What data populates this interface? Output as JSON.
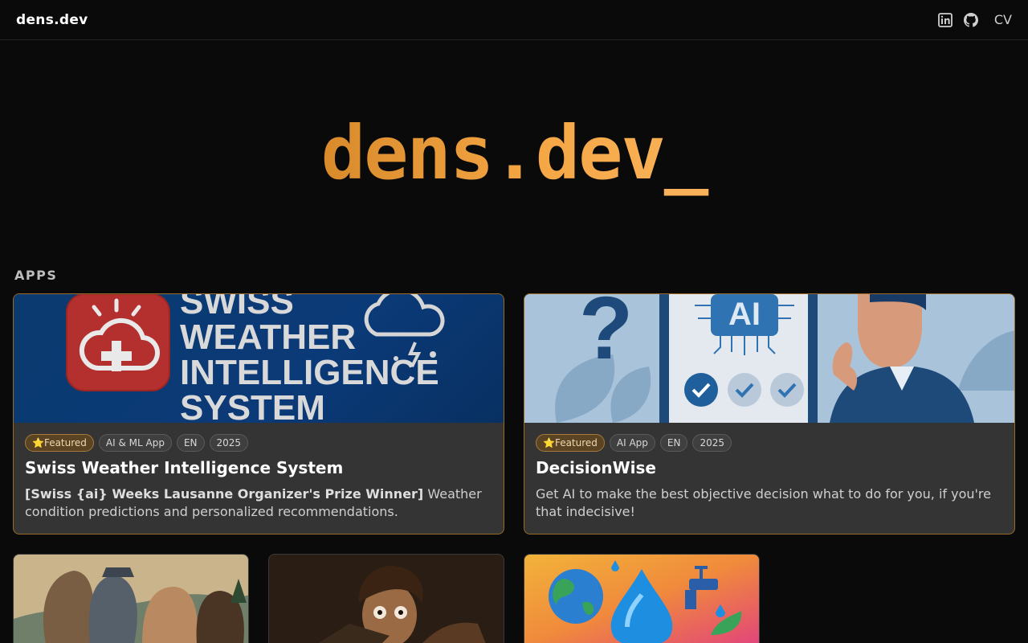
{
  "header": {
    "brand": "dens.dev",
    "nav": {
      "cv_label": "CV"
    }
  },
  "hero": {
    "title_name": "dens",
    "title_dot": ".",
    "title_tld": "dev",
    "title_cursor": "_"
  },
  "section": {
    "label": "APPS"
  },
  "cards": [
    {
      "tags": [
        "⭐Featured",
        "AI & ML App",
        "EN",
        "2025"
      ],
      "title": "Swiss Weather Intelligence System",
      "desc_bold": "[Swiss {ai} Weeks Lausanne Organizer's Prize Winner]",
      "desc": " Weather condition predictions and personalized recommendations.",
      "image_text": [
        "SWISS",
        "WEATHER",
        "INTELLIGENCE",
        "SYSTEM"
      ]
    },
    {
      "tags": [
        "⭐Featured",
        "AI App",
        "EN",
        "2025"
      ],
      "title": "DecisionWise",
      "desc": "Get AI to make the best objective decision what to do for you, if you're that indecisive!",
      "image_text": [
        "AI"
      ]
    }
  ],
  "colors": {
    "accent": "#f6a847",
    "background": "#0a0a0a",
    "card_bg": "#343434",
    "featured_border": "#9a6a2a"
  },
  "icons": [
    "linkedin-icon",
    "github-icon"
  ]
}
